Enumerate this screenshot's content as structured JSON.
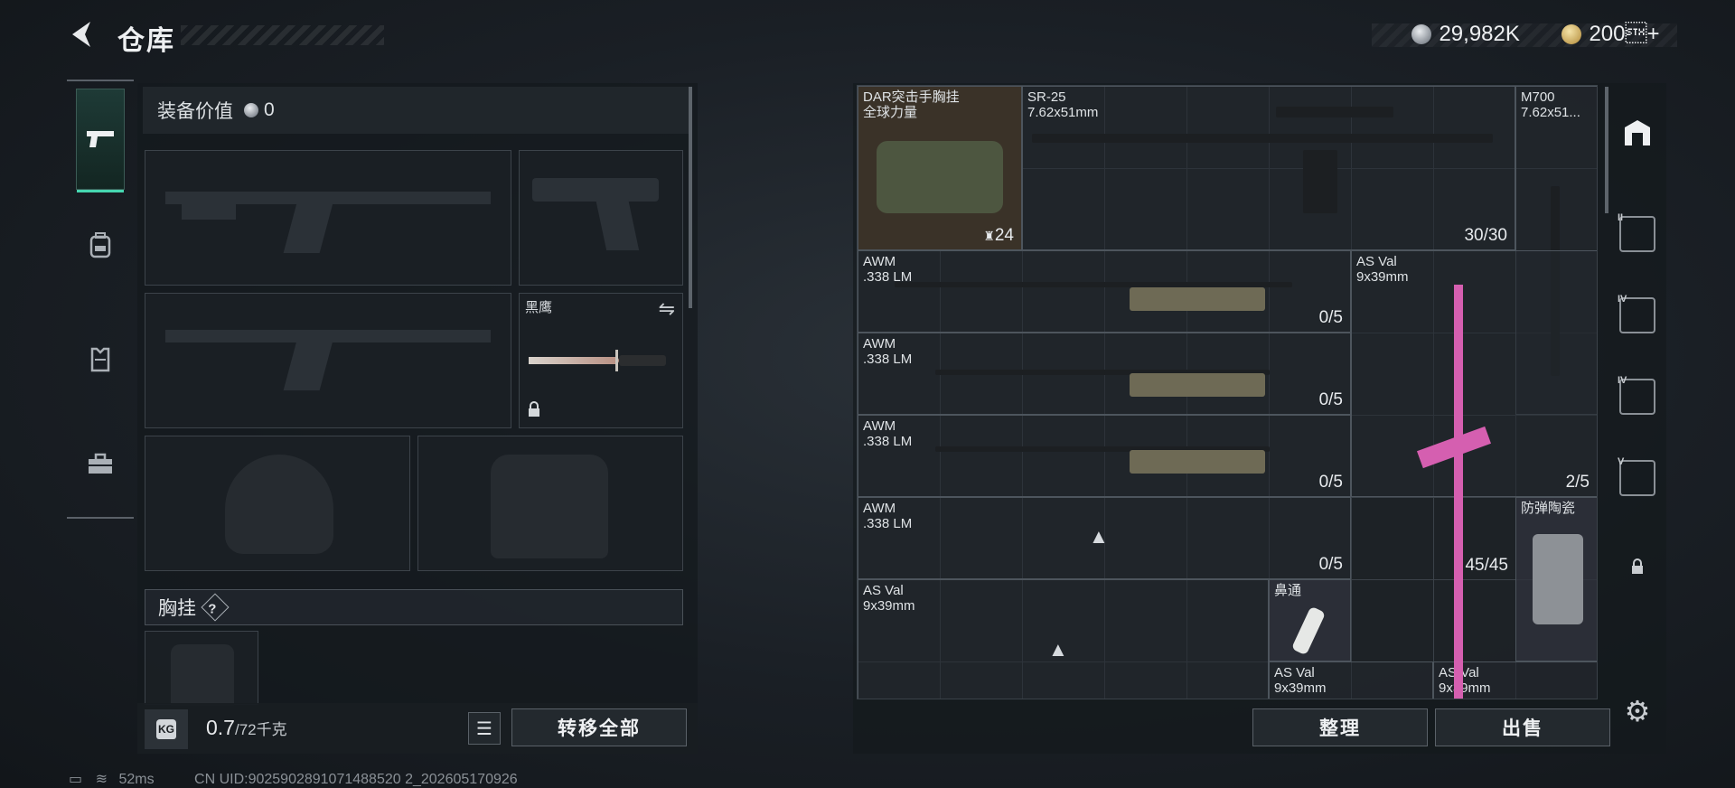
{
  "header": {
    "back_icon": "back-arrow-icon",
    "title": "仓库",
    "currency_silver": "29,982K",
    "currency_gold": "200\u0002+"
  },
  "left_nav": {
    "tabs": [
      {
        "icon": "pistol-icon",
        "active": true
      },
      {
        "icon": "backpack-icon",
        "active": false
      },
      {
        "icon": "vest-icon",
        "active": false
      },
      {
        "icon": "toolbox-icon",
        "active": false
      }
    ]
  },
  "loadout": {
    "value_label": "装备价值",
    "value": "0",
    "melee_label": "黑鹰",
    "chest_rig_label": "胸挂",
    "help": "?",
    "weight_value": "0.7",
    "weight_max": "/72千克",
    "weight_icon_label": "KG",
    "transfer_all": "转移全部"
  },
  "inventory": {
    "items": [
      {
        "name": "DAR突击手胸挂\n全球力量",
        "count": "24"
      },
      {
        "name": "SR-25\n7.62x51mm",
        "count": "30/30"
      },
      {
        "name": "M700\n7.62x51...",
        "count": ""
      },
      {
        "name": "AWM\n.338 LM",
        "count": "0/5"
      },
      {
        "name": "AS Val\n9x39mm",
        "count": "2/5"
      },
      {
        "name": "AWM\n.338 LM",
        "count": "0/5"
      },
      {
        "name": "AWM\n.338 LM",
        "count": "0/5"
      },
      {
        "name": "AWM\n.338 LM",
        "count": "0/5"
      },
      {
        "name": "防弹陶瓷",
        "count": ""
      },
      {
        "name": "AS Val\n9x39mm",
        "count": ""
      },
      {
        "name": "鼻通",
        "count": ""
      },
      {
        "name": "AS Val\n9x39mm",
        "count": "45/45"
      },
      {
        "name": "AS Val\n9x39mm",
        "count": ""
      }
    ],
    "sort_button": "整理",
    "sell_button": "出售"
  },
  "status_bar": {
    "ping": "52ms",
    "uid": "CN UID:9025902891071488520 2_202605170926"
  }
}
